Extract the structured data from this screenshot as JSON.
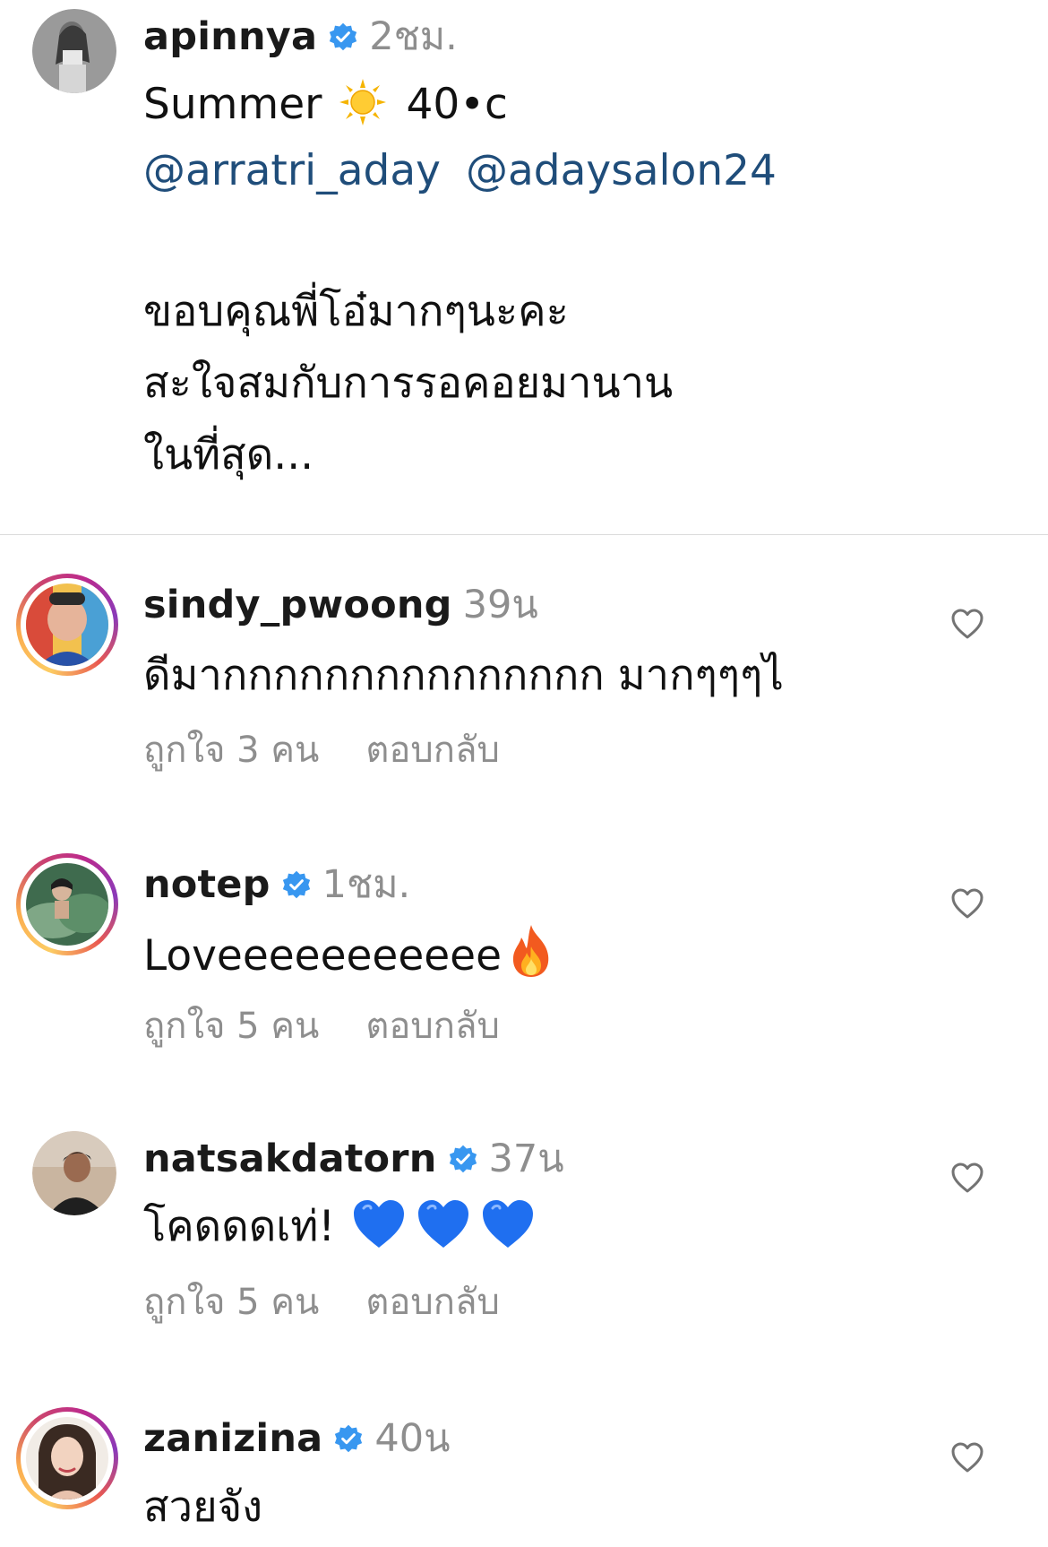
{
  "post": {
    "username": "apinnya",
    "verified": true,
    "time": "2ชม.",
    "caption_line1_text": "Summer",
    "caption_line1_emoji": "sun-emoji",
    "caption_line1_suffix": "40•c",
    "mentions": [
      "@arratri_aday",
      "@adaysalon24"
    ],
    "caption_lines": [
      "ขอบคุณพี่โอ๋มากๆนะคะ",
      "สะใจสมกับการรอคอยมานาน",
      "ในที่สุด..."
    ]
  },
  "comments": [
    {
      "username": "sindy_pwoong",
      "verified": false,
      "time": "39น",
      "text": "ดีมากกกกกกกกกกกกกกก มากๆๆๆไ",
      "likes": "ถูกใจ 3 คน",
      "reply": "ตอบกลับ"
    },
    {
      "username": "notep",
      "verified": true,
      "time": "1ชม.",
      "text": "Loveeeeeeeeeee",
      "emoji": "fire-emoji",
      "likes": "ถูกใจ 5 คน",
      "reply": "ตอบกลับ"
    },
    {
      "username": "natsakdatorn",
      "verified": true,
      "time": "37น",
      "text": "โคดดดเท่!",
      "emoji": "blue-heart-emoji x3",
      "likes": "ถูกใจ 5 คน",
      "reply": "ตอบกลับ"
    },
    {
      "username": "zanizina",
      "verified": true,
      "time": "40น",
      "text": "สวยจัง"
    }
  ],
  "colors": {
    "mention": "#1f4d7a",
    "muted": "#8e8e8e",
    "verified": "#3897f0",
    "divider": "#dbdbdb"
  }
}
